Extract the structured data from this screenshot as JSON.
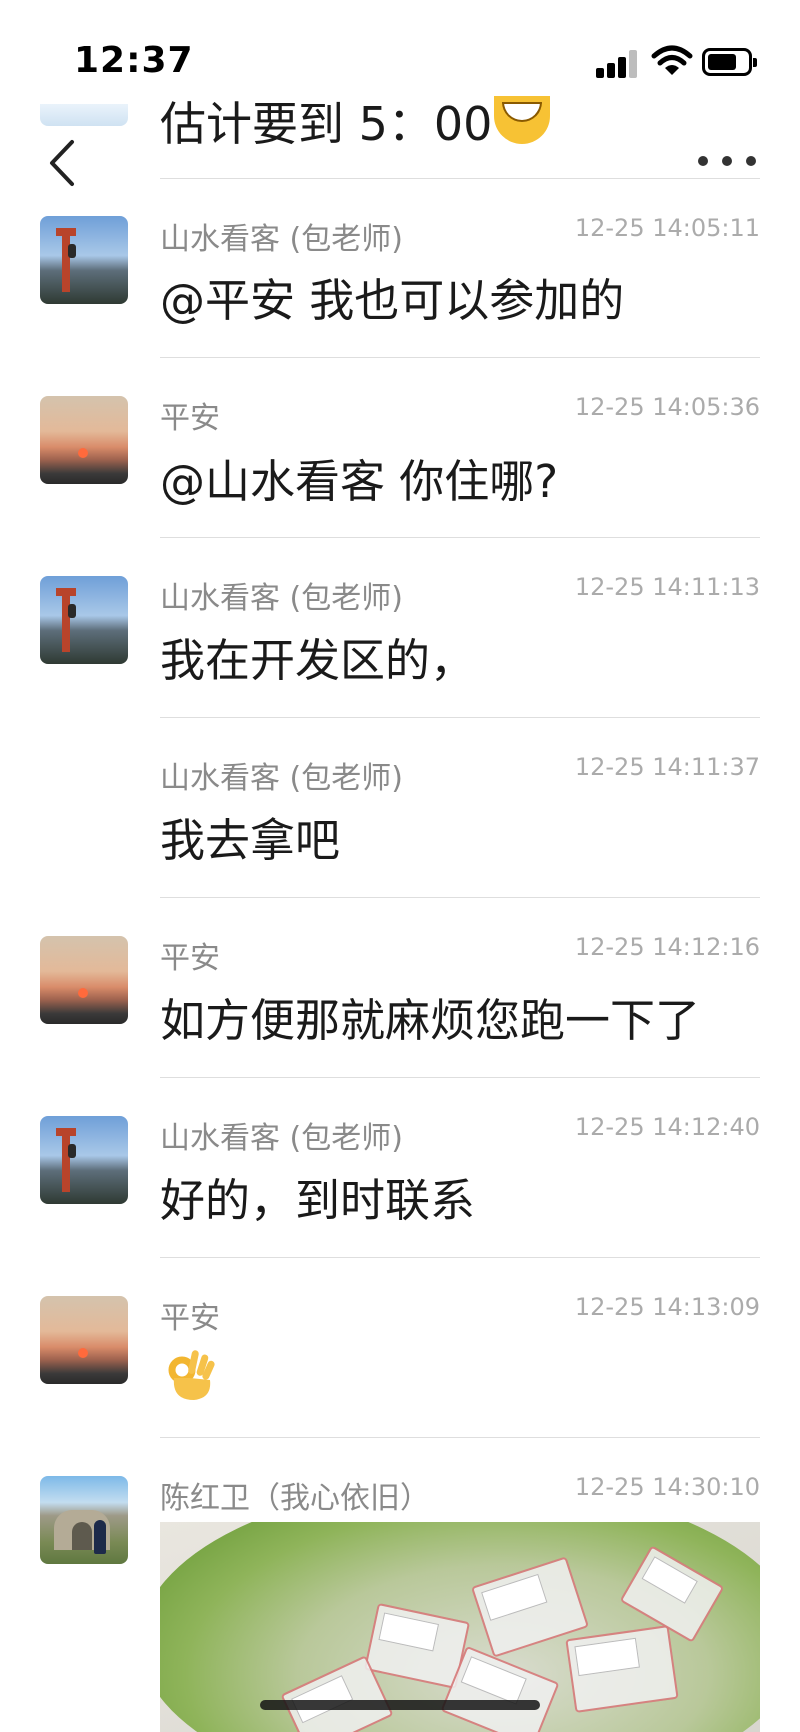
{
  "status_bar": {
    "time": "12:37"
  },
  "header": {
    "prev_message_fragment": "估计要到 5：00"
  },
  "messages": [
    {
      "sender": "山水看客 (包老师)",
      "time": "12-25 14:05:11",
      "text": "@平安 我也可以参加的"
    },
    {
      "sender": "平安",
      "time": "12-25 14:05:36",
      "text": "@山水看客 你住哪?"
    },
    {
      "sender": "山水看客 (包老师)",
      "time": "12-25 14:11:13",
      "text": "我在开发区的，"
    },
    {
      "sender": "山水看客 (包老师)",
      "time": "12-25 14:11:37",
      "text": "我去拿吧"
    },
    {
      "sender": "平安",
      "time": "12-25 14:12:16",
      "text": "如方便那就麻烦您跑一下了"
    },
    {
      "sender": "山水看客 (包老师)",
      "time": "12-25 14:12:40",
      "text": "好的，到时联系"
    },
    {
      "sender": "平安",
      "time": "12-25 14:13:09",
      "text": ""
    },
    {
      "sender": "陈红卫（我心依旧）",
      "time": "12-25 14:30:10",
      "text": ""
    }
  ],
  "icons": {
    "back": "chevron-left-icon",
    "more": "ellipsis-icon",
    "ok_emoji": "ok-hand-icon",
    "grin_emoji": "grinning-face-icon"
  }
}
